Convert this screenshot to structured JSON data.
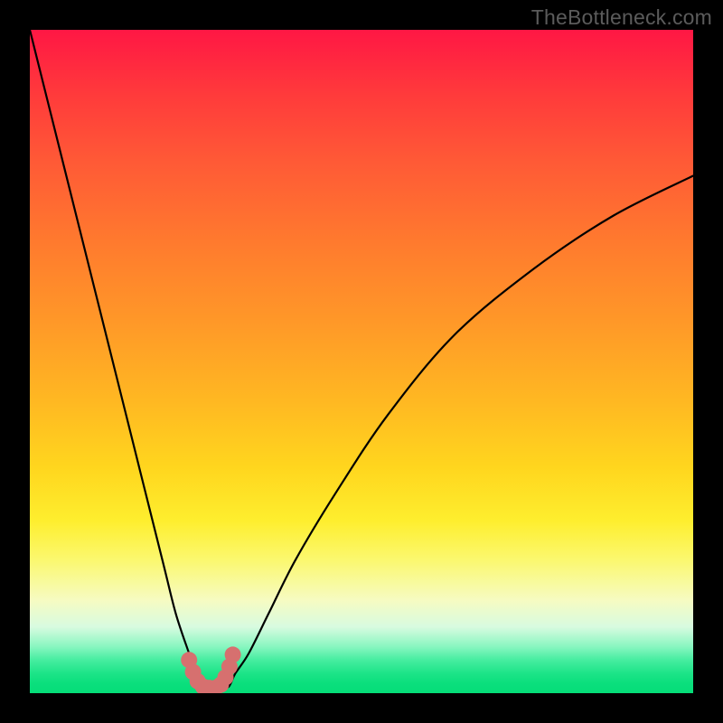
{
  "watermark": "TheBottleneck.com",
  "chart_data": {
    "type": "line",
    "title": "",
    "xlabel": "",
    "ylabel": "",
    "xlim": [
      0,
      100
    ],
    "ylim": [
      0,
      100
    ],
    "series": [
      {
        "name": "bottleneck-curve",
        "x": [
          0,
          5,
          10,
          15,
          20,
          22,
          24,
          25,
          26,
          27,
          28,
          29,
          30,
          31,
          33,
          36,
          40,
          46,
          54,
          64,
          76,
          88,
          100
        ],
        "values": [
          100,
          80,
          60,
          40,
          20,
          12,
          6,
          3,
          1,
          1,
          1,
          1,
          1,
          3,
          6,
          12,
          20,
          30,
          42,
          54,
          64,
          72,
          78
        ]
      }
    ],
    "markers": {
      "name": "sweet-spot",
      "color": "#d6706f",
      "points_x": [
        24.0,
        24.6,
        25.3,
        26.1,
        27.0,
        28.0,
        28.8,
        29.5,
        30.1,
        30.6
      ],
      "points_y": [
        5.0,
        3.2,
        1.8,
        1.0,
        0.8,
        0.8,
        1.3,
        2.4,
        4.0,
        5.8
      ]
    },
    "gradient_stops": [
      {
        "pos": 0,
        "color": "#ff1744"
      },
      {
        "pos": 10,
        "color": "#ff3b3b"
      },
      {
        "pos": 20,
        "color": "#ff5a36"
      },
      {
        "pos": 32,
        "color": "#ff7a2e"
      },
      {
        "pos": 44,
        "color": "#ff9828"
      },
      {
        "pos": 56,
        "color": "#ffb822"
      },
      {
        "pos": 66,
        "color": "#ffd61e"
      },
      {
        "pos": 74,
        "color": "#feee2e"
      },
      {
        "pos": 80,
        "color": "#fbf870"
      },
      {
        "pos": 86,
        "color": "#f6fbc2"
      },
      {
        "pos": 90,
        "color": "#d8fbe0"
      },
      {
        "pos": 93,
        "color": "#88f6c0"
      },
      {
        "pos": 95,
        "color": "#46eda0"
      },
      {
        "pos": 97,
        "color": "#1de488"
      },
      {
        "pos": 98.5,
        "color": "#0bdf7d"
      },
      {
        "pos": 100,
        "color": "#05dd78"
      }
    ]
  }
}
